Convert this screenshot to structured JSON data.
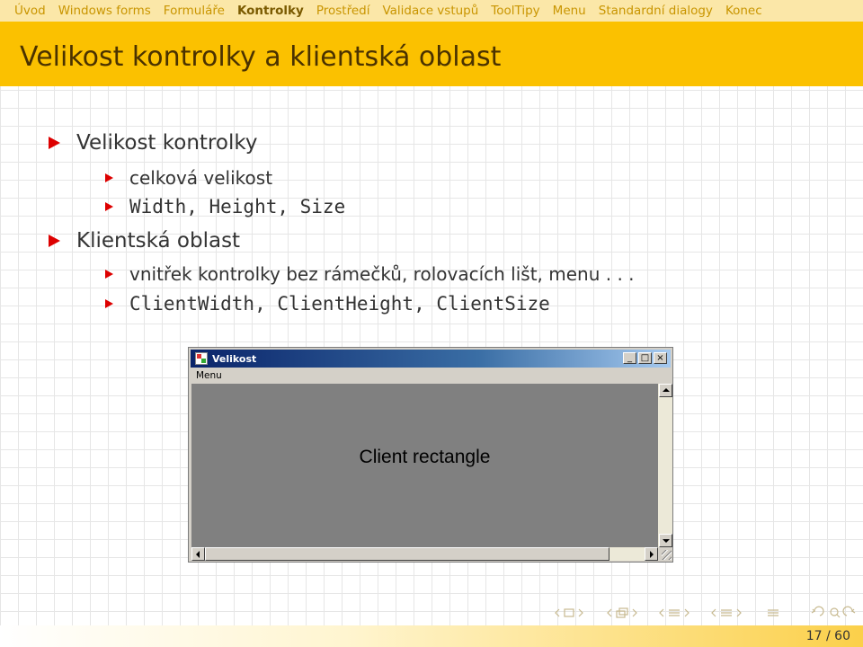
{
  "nav": {
    "items": [
      "Úvod",
      "Windows forms",
      "Formuláře",
      "Kontrolky",
      "Prostředí",
      "Validace vstupů",
      "ToolTipy",
      "Menu",
      "Standardní dialogy",
      "Konec"
    ],
    "active_index": 3
  },
  "frame_title": "Velikost kontrolky a klientská oblast",
  "bullets": {
    "b1": "Velikost kontrolky",
    "b1_sub1": "celková velikost",
    "b1_sub2": "Width, Height, Size",
    "b2": "Klientská oblast",
    "b2_sub1": "vnitřek kontrolky bez rámečků, rolovacích lišt, menu . . .",
    "b2_sub2": "ClientWidth, ClientHeight, ClientSize"
  },
  "winform": {
    "title": "Velikost",
    "menu_item": "Menu",
    "client_label": "Client rectangle"
  },
  "footer": {
    "page": "17 / 60"
  },
  "colors": {
    "accent": "#fbc100",
    "bullet": "#dd0000",
    "nav_text": "#c99500",
    "client_area": "#808080"
  }
}
